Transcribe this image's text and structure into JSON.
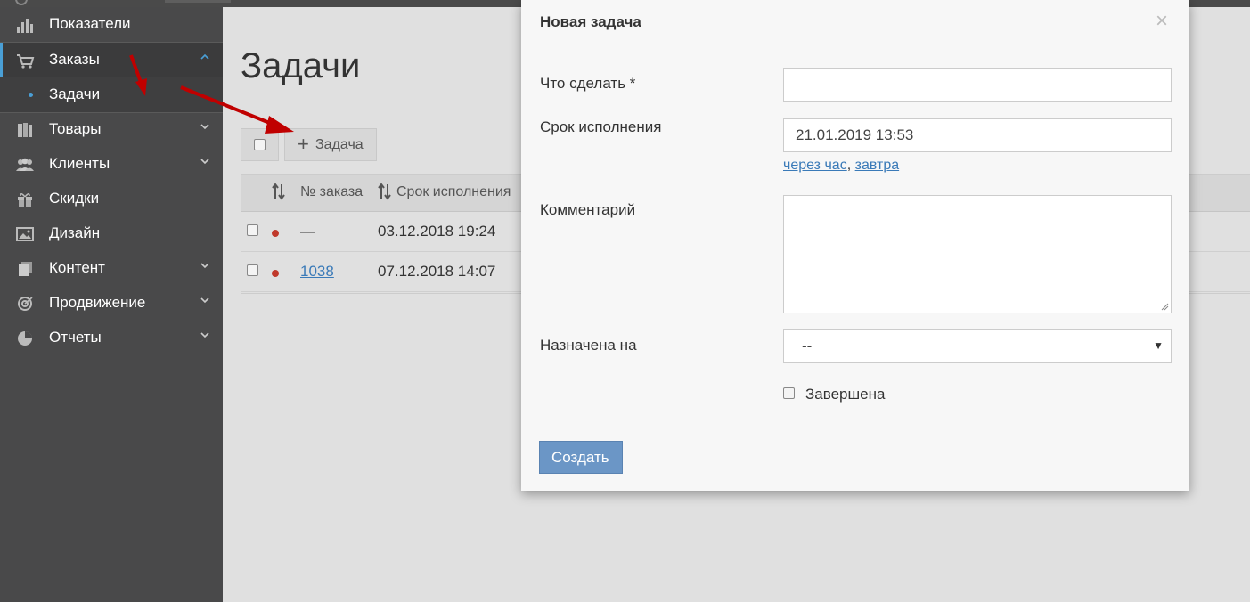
{
  "sidebar": {
    "items": [
      {
        "label": "Показатели",
        "icon": "bar-chart-icon"
      },
      {
        "label": "Заказы",
        "icon": "cart-icon"
      },
      {
        "label": "Задачи"
      },
      {
        "label": "Товары",
        "icon": "books-icon"
      },
      {
        "label": "Клиенты",
        "icon": "users-icon"
      },
      {
        "label": "Скидки",
        "icon": "gift-icon"
      },
      {
        "label": "Дизайн",
        "icon": "image-icon"
      },
      {
        "label": "Контент",
        "icon": "pages-icon"
      },
      {
        "label": "Продвижение",
        "icon": "target-icon"
      },
      {
        "label": "Отчеты",
        "icon": "pie-chart-icon"
      }
    ]
  },
  "main": {
    "title": "Задачи",
    "add_button": "Задача",
    "table": {
      "headers": [
        "№ заказа",
        "Срок исполнения"
      ],
      "rows": [
        {
          "order": "—",
          "due": "03.12.2018 19:24",
          "status_color": "#c0392b"
        },
        {
          "order": "1038",
          "due": "07.12.2018 14:07",
          "status_color": "#c0392b"
        }
      ]
    }
  },
  "modal": {
    "title": "Новая задача",
    "close_symbol": "×",
    "what_label": "Что сделать *",
    "what_value": "",
    "due_label": "Срок исполнения",
    "due_value": "21.01.2019 13:53",
    "quick_hour": "через час",
    "quick_sep": ",",
    "quick_tomorrow": "завтра",
    "comment_label": "Комментарий",
    "assigned_label": "Назначена на",
    "assigned_value": "--",
    "done_label": "Завершена",
    "submit_label": "Создать"
  },
  "colors": {
    "sidebar_bg": "#49494a",
    "accent": "#4a9fd6",
    "primary_button": "#6b96c6",
    "annotation_arrow": "#c00000"
  }
}
